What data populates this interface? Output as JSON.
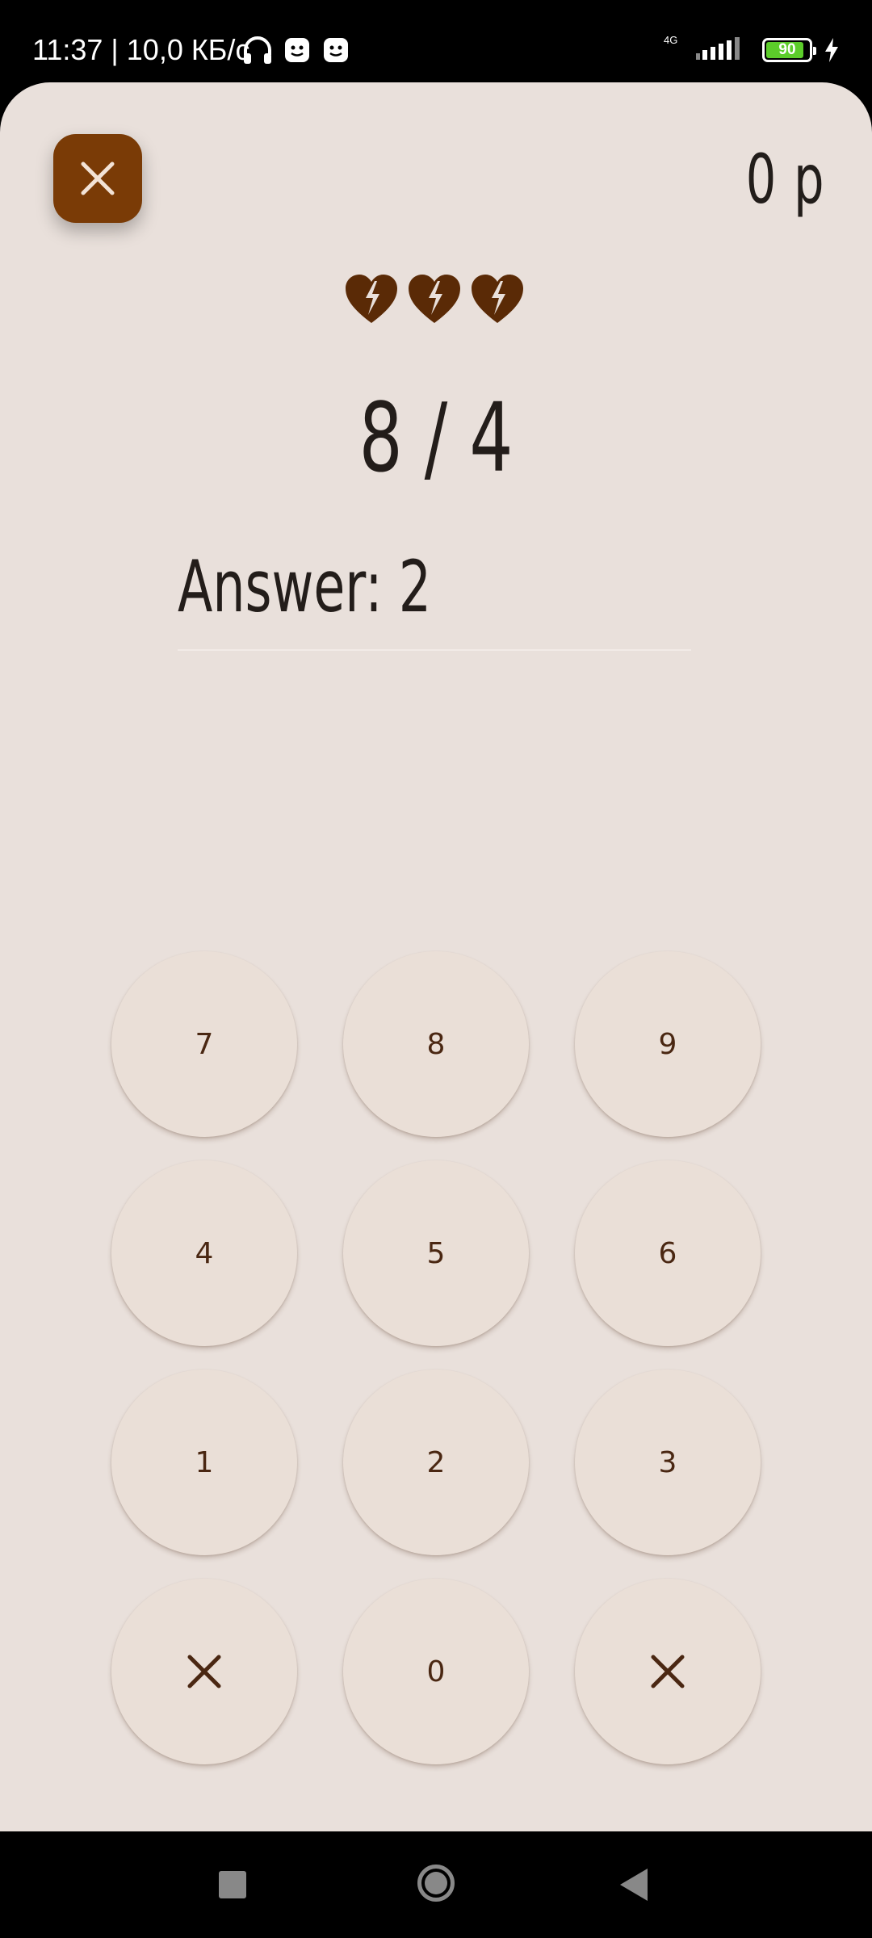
{
  "status_bar": {
    "time": "11:37 | 10,0 КБ/с",
    "network_label": "4G",
    "battery_percent": "90",
    "battery_level": 0.9
  },
  "game": {
    "score": "0 p",
    "lives_icons": [
      "broken-heart-icon",
      "broken-heart-icon",
      "broken-heart-icon"
    ],
    "problem": "8 / 4",
    "answer": "Answer: 2"
  },
  "keypad": {
    "keys": [
      "7",
      "8",
      "9",
      "4",
      "5",
      "6",
      "1",
      "2",
      "3",
      "0"
    ]
  },
  "colors": {
    "background": "#e9e0db",
    "accent": "#7a3b06",
    "heart": "#5a2a06",
    "key": "#eadfd7",
    "key_text": "#4a2712"
  }
}
